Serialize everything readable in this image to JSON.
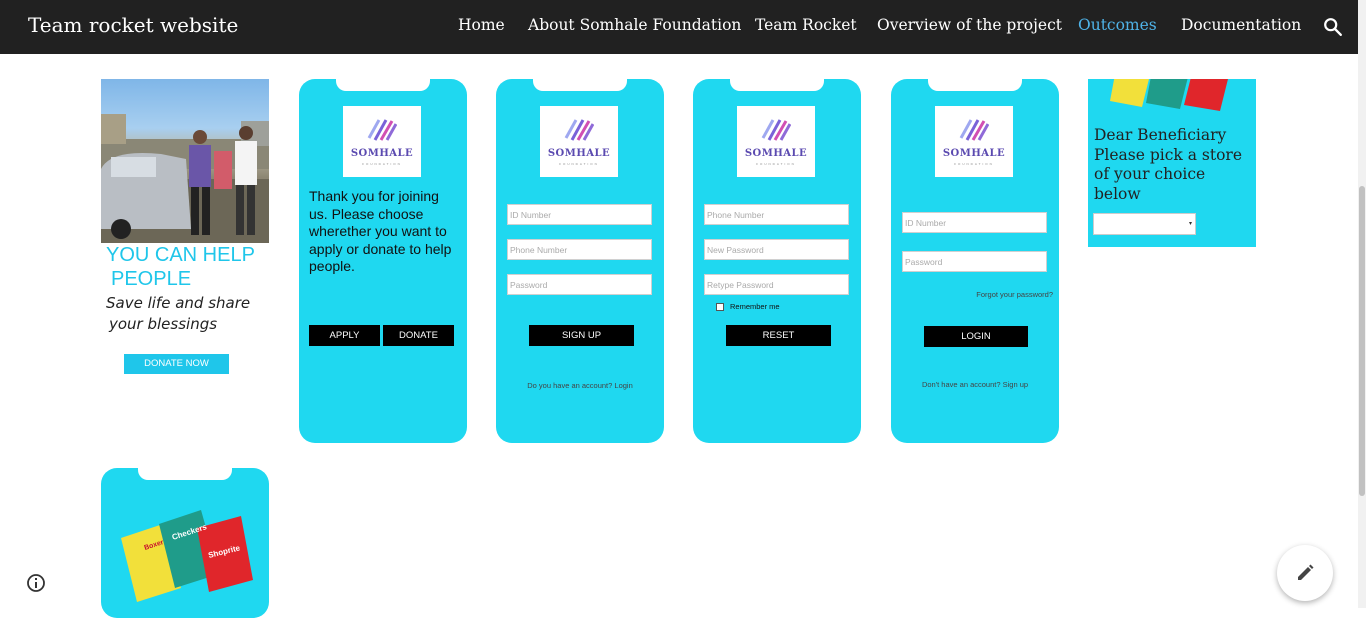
{
  "header": {
    "site_title": "Team rocket website",
    "nav": [
      "Home",
      "About Somhale Foundation",
      "Team Rocket",
      "Overview of the project",
      "Outcomes",
      "Documentation"
    ],
    "active_nav": "Outcomes",
    "search_icon": "search-icon"
  },
  "donate_card": {
    "title_line1": "YOU CAN HELP",
    "title_line2": "PEOPLE",
    "sub_line1": "Save life and share",
    "sub_line2": "your blessings",
    "button": "DONATE NOW"
  },
  "logo": {
    "brand": "SOMHALE",
    "tagline": "FOUNDATION"
  },
  "welcome_card": {
    "message": "Thank you for joining us. Please choose wherether you want to apply or donate to help people.",
    "apply_button": "APPLY",
    "donate_button": "DONATE"
  },
  "signup_card": {
    "fields": [
      "ID Number",
      "Phone Number",
      "Password"
    ],
    "button": "SIGN UP",
    "footer": "Do you have an account? Login"
  },
  "reset_card": {
    "fields": [
      "Phone Number",
      "New Password",
      "Retype Password"
    ],
    "remember": "Remember me",
    "button": "RESET"
  },
  "login_card": {
    "fields": [
      "ID Number",
      "Password"
    ],
    "forgot": "Forgot your password?",
    "button": "LOGIN",
    "footer": "Don't have an account?  Sign up"
  },
  "store_card": {
    "text_line1": "Dear Beneficiary",
    "text_line2": "Please pick a store",
    "text_line3": "of your choice",
    "text_line4": "below"
  },
  "vouchers_card": {
    "vouchers": [
      "Boxer",
      "Checkers",
      "Shoprite"
    ]
  },
  "colors": {
    "accent": "#1fd8f0",
    "topbar": "#212121",
    "active_nav": "#4fb3e8"
  }
}
